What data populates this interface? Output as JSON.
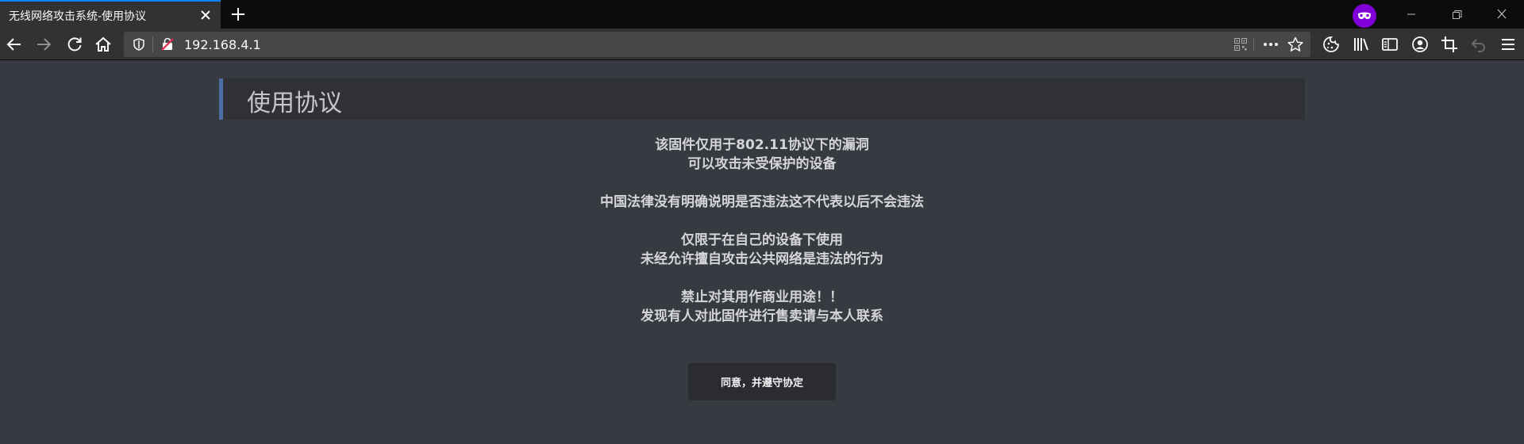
{
  "tab": {
    "title": "无线网络攻击系统-使用协议"
  },
  "urlbar": {
    "url": "192.168.4.1"
  },
  "icons": {
    "tab_close": "close-icon",
    "new_tab": "plus-icon",
    "private": "private-mask-icon",
    "back": "back-arrow-icon",
    "forward": "forward-arrow-icon",
    "reload": "reload-icon",
    "home": "home-icon",
    "tracking": "shield-icon",
    "insecure": "insecure-lock-icon",
    "qr": "qr-code-icon",
    "more": "ellipsis-icon",
    "bookmark": "star-icon",
    "cookie": "cookie-icon",
    "library": "library-icon",
    "sidebar": "sidebar-icon",
    "account": "account-icon",
    "crop": "screenshot-crop-icon",
    "undo": "undo-icon",
    "menu": "hamburger-menu-icon"
  },
  "colors": {
    "accent_tab": "#0a84ff",
    "header_accent": "#4a6fa5",
    "private_badge": "#8000d7",
    "page_bg": "#383a41"
  },
  "page": {
    "title": "使用协议",
    "paragraphs": [
      [
        "该固件仅用于802.11协议下的漏洞",
        "可以攻击未受保护的设备"
      ],
      [
        "中国法律没有明确说明是否违法这不代表以后不会违法"
      ],
      [
        "仅限于在自己的设备下使用",
        "未经允许擅自攻击公共网络是违法的行为"
      ],
      [
        "禁止对其用作商业用途！！",
        "发现有人对此固件进行售卖请与本人联系"
      ]
    ],
    "agree_button": "同意，并遵守协定"
  }
}
